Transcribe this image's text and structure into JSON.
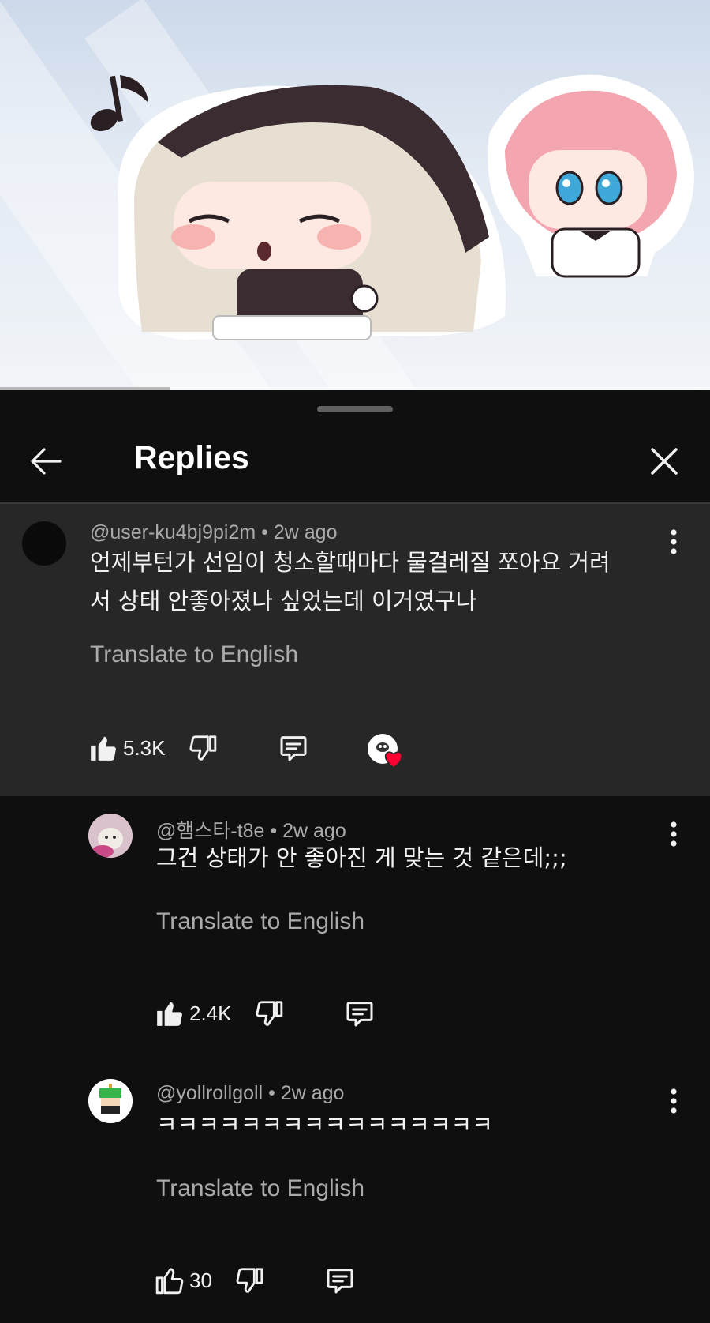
{
  "colors": {
    "background": "#0f0f0f",
    "highlight_row": "#272727",
    "secondary_text": "#aaaaaa",
    "heart": "#ff0033"
  },
  "video": {
    "progress_fraction": 0.24
  },
  "sheet": {
    "title": "Replies"
  },
  "comments": [
    {
      "author": "@user-ku4bj9pi2m",
      "age": "2w ago",
      "text_line1": "언제부턴가 선임이 청소할때마다 물걸레질 쪼아요 거려",
      "text_line2": "서 상태 안좋아졌나 싶었는데 이거였구나",
      "translate": "Translate to English",
      "likes": "5.3K",
      "creator_heart": true
    },
    {
      "author": "@햄스타-t8e",
      "age": "2w ago",
      "text_line1": "그건 상태가 안 좋아진 게 맞는 것 같은데;;;",
      "translate": "Translate to English",
      "likes": "2.4K"
    },
    {
      "author": "@yollrollgoll",
      "age": "2w ago",
      "text_line1": "ㅋㅋㅋㅋㅋㅋㅋㅋㅋㅋㅋㅋㅋㅋㅋㅋ",
      "translate": "Translate to English",
      "likes": "30"
    }
  ]
}
